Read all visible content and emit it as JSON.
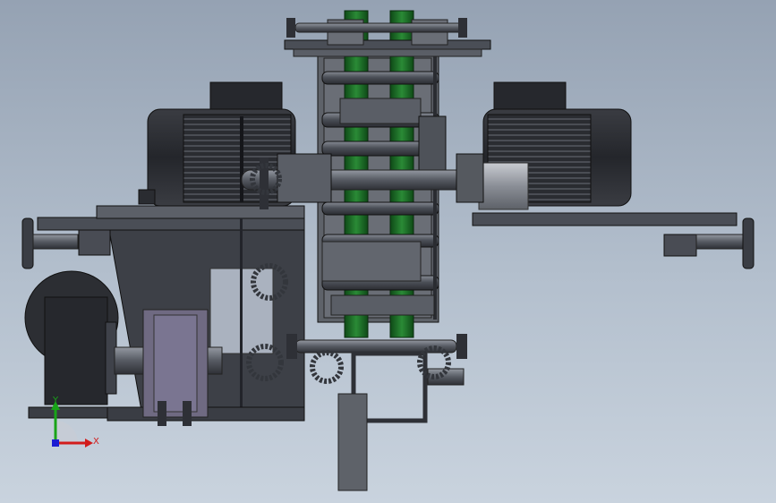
{
  "viewport": {
    "background": "#aab5c4"
  },
  "triad": {
    "y_label": "Y",
    "x_label": "X",
    "y_color": "#18a418",
    "x_color": "#d21c1c",
    "z_color": "#1c1cd2"
  },
  "colors": {
    "frame": "#3b3e45",
    "frame_light": "#5a5e66",
    "steel": "#6a6f78",
    "steel_light": "#8c9099",
    "motor": "#2c2e33",
    "belt_green": "#1c6a24",
    "purple_block": "#6f6a82"
  }
}
